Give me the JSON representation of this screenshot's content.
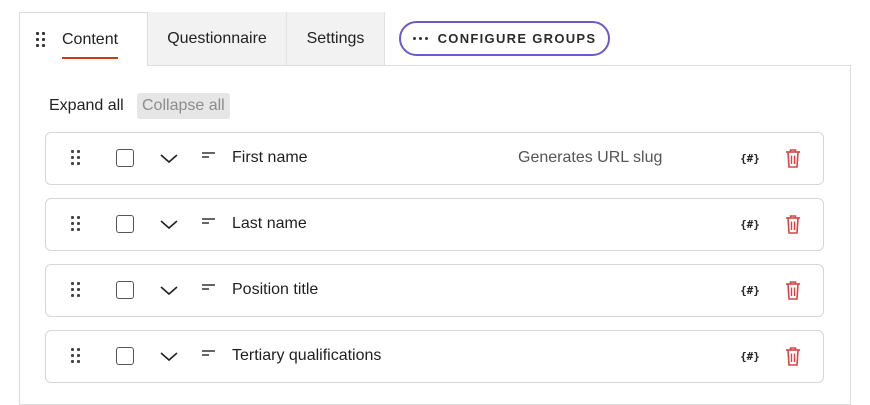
{
  "tabs": [
    {
      "label": "Content",
      "active": true
    },
    {
      "label": "Questionnaire",
      "active": false
    },
    {
      "label": "Settings",
      "active": false
    }
  ],
  "configure_groups": {
    "label": "CONFIGURE GROUPS",
    "icon": "more-dots-icon"
  },
  "toolbar": {
    "expand_all": "Expand all",
    "collapse_all": "Collapse all"
  },
  "fields": [
    {
      "label": "First name",
      "note": "Generates URL slug",
      "token": "{#}"
    },
    {
      "label": "Last name",
      "note": "",
      "token": "{#}"
    },
    {
      "label": "Position title",
      "note": "",
      "token": "{#}"
    },
    {
      "label": "Tertiary qualifications",
      "note": "",
      "token": "{#}"
    }
  ],
  "colors": {
    "accent": "#c4410f",
    "button_border": "#6a5acd",
    "delete": "#d64545"
  }
}
